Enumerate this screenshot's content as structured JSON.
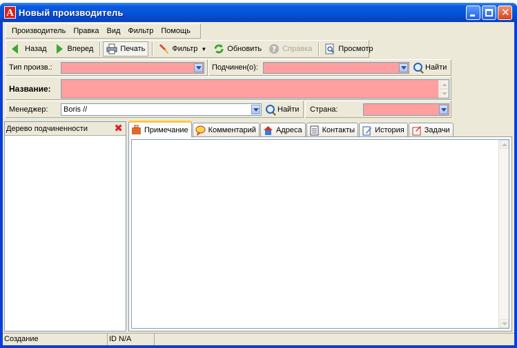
{
  "window": {
    "title": "Новый производитель"
  },
  "menu": [
    "Производитель",
    "Правка",
    "Вид",
    "Фильтр",
    "Помощь"
  ],
  "toolbar": {
    "back": "Назад",
    "forward": "Вперед",
    "print": "Печать",
    "filter": "Фильтр",
    "refresh": "Обновить",
    "help": "Справка",
    "preview": "Просмотр"
  },
  "form": {
    "type_label": "Тип произв.:",
    "type_value": "",
    "parent_label": "Подчинен(о):",
    "parent_value": "",
    "find_label": "Найти",
    "name_label": "Название:",
    "name_value": "",
    "manager_label": "Менеджер:",
    "manager_value": "Boris //",
    "manager_find": "Найти",
    "country_label": "Страна:",
    "country_value": ""
  },
  "tree": {
    "title": "Дерево подчиненности"
  },
  "tabs": [
    "Примечание",
    "Комментарий",
    "Адреса",
    "Контакты",
    "История",
    "Задачи"
  ],
  "active_tab": "Примечание",
  "status": {
    "mode": "Создание",
    "id": "ID N/A"
  },
  "colors": {
    "required_field": "#ff9f9f",
    "title_bar": "#0754d8",
    "face": "#ece9d8"
  }
}
